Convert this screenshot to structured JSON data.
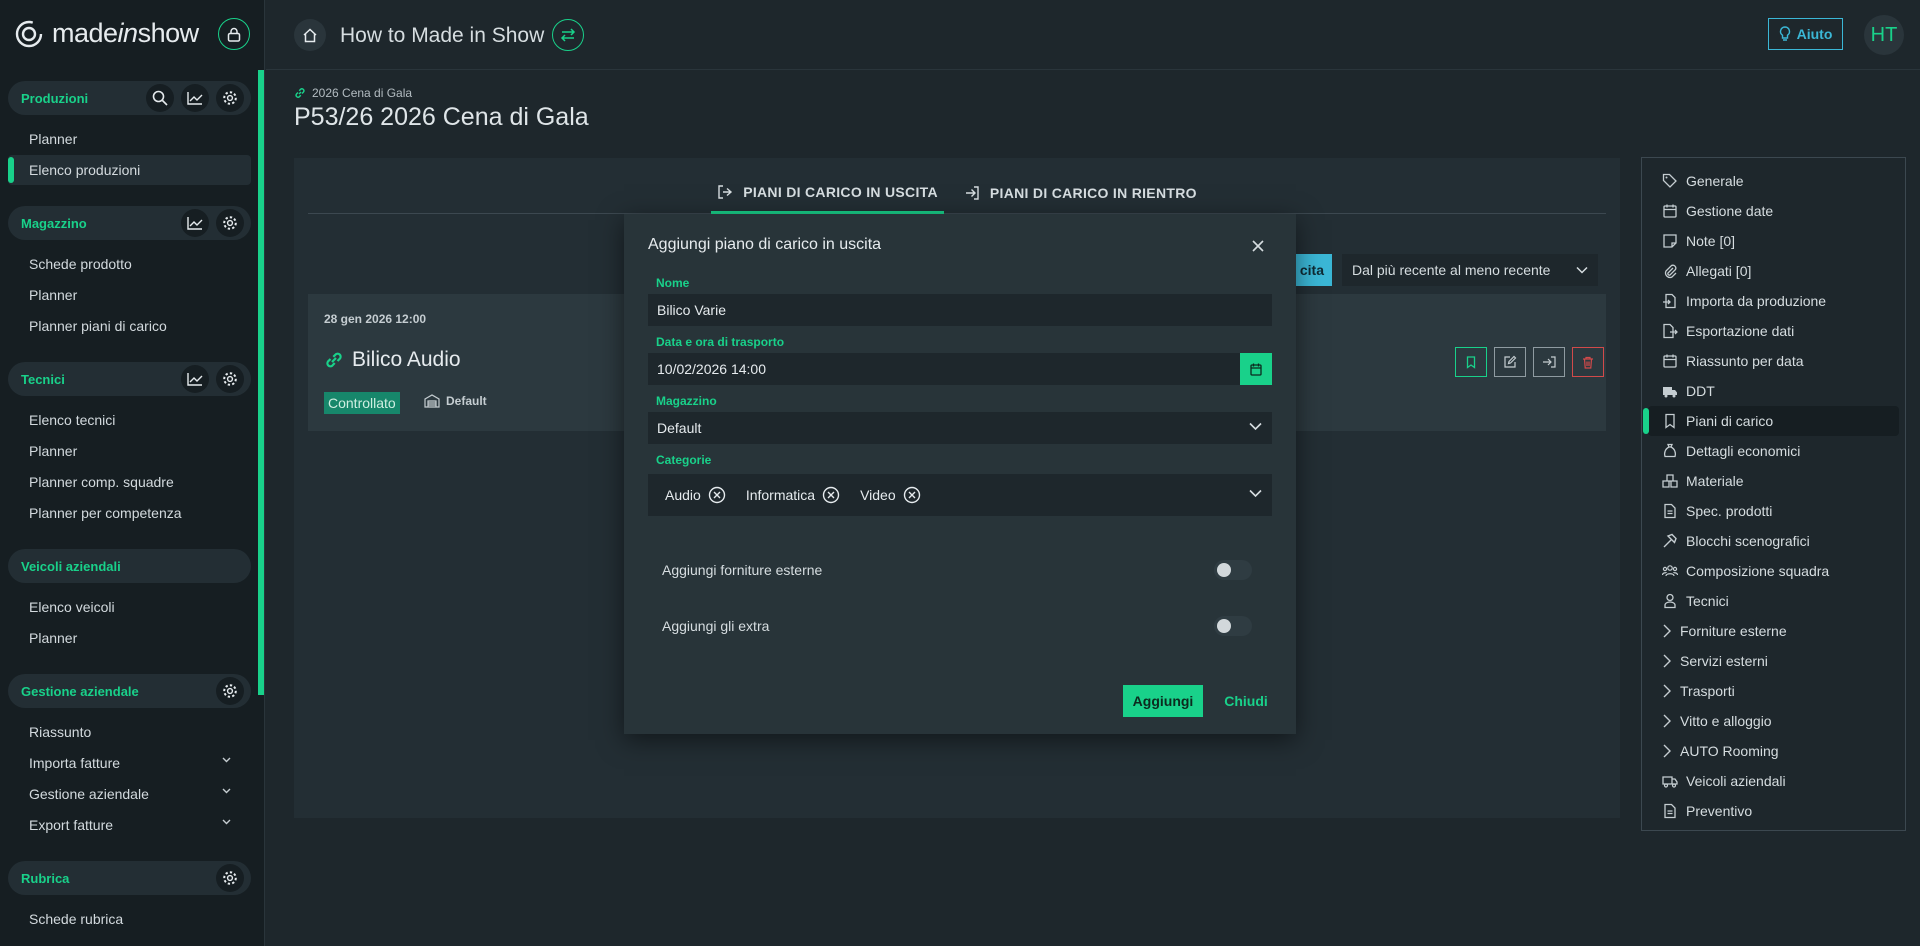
{
  "brand": {
    "name_pre": "made",
    "name_mid": "in",
    "name_post": "show"
  },
  "accent": "#19d18a",
  "info_color": "#3bb7d6",
  "sidebar": {
    "sections": [
      {
        "title": "Produzioni",
        "items": [
          "Planner",
          "Elenco produzioni"
        ],
        "active_item": "Elenco produzioni"
      },
      {
        "title": "Magazzino",
        "items": [
          "Schede prodotto",
          "Planner",
          "Planner piani di carico"
        ]
      },
      {
        "title": "Tecnici",
        "items": [
          "Elenco tecnici",
          "Planner",
          "Planner comp. squadre",
          "Planner per competenza"
        ]
      },
      {
        "title": "Veicoli aziendali",
        "items": [
          "Elenco veicoli",
          "Planner"
        ]
      },
      {
        "title": "Gestione aziendale",
        "items": [
          "Riassunto",
          "Importa fatture",
          "Gestione aziendale",
          "Export fatture"
        ]
      },
      {
        "title": "Rubrica",
        "items": [
          "Schede rubrica"
        ]
      }
    ]
  },
  "topbar": {
    "title": "How to Made in Show",
    "help_label": "Aiuto",
    "avatar_initials": "HT"
  },
  "breadcrumb": "2026 Cena di Gala",
  "page_title": "P53/26 2026 Cena di Gala",
  "tabs": [
    {
      "label": "PIANI DI CARICO IN USCITA",
      "icon": "sign-out-icon",
      "active": true
    },
    {
      "label": "PIANI DI CARICO IN RIENTRO",
      "icon": "sign-in-icon",
      "active": false
    }
  ],
  "toolbar": {
    "new_label_partial": "cita",
    "sort_value": "Dal più recente al meno recente"
  },
  "card": {
    "date": "28 gen 2026 12:00",
    "title": "Bilico Audio",
    "status": "Controllato",
    "warehouse": "Default"
  },
  "right_nav": [
    {
      "label": "Generale",
      "icon": "tag-icon"
    },
    {
      "label": "Gestione date",
      "icon": "calendar-icon"
    },
    {
      "label": "Note [0]",
      "icon": "note-icon"
    },
    {
      "label": "Allegati [0]",
      "icon": "paperclip-icon"
    },
    {
      "label": "Importa da produzione",
      "icon": "import-icon"
    },
    {
      "label": "Esportazione dati",
      "icon": "export-icon"
    },
    {
      "label": "Riassunto per data",
      "icon": "calendar-icon"
    },
    {
      "label": "DDT",
      "icon": "truck-icon"
    },
    {
      "label": "Piani di carico",
      "icon": "bookmark-icon",
      "active": true
    },
    {
      "label": "Dettagli economici",
      "icon": "money-bag-icon"
    },
    {
      "label": "Materiale",
      "icon": "boxes-icon"
    },
    {
      "label": "Spec. prodotti",
      "icon": "file-icon"
    },
    {
      "label": "Blocchi scenografici",
      "icon": "hammer-icon"
    },
    {
      "label": "Composizione squadra",
      "icon": "team-icon"
    },
    {
      "label": "Tecnici",
      "icon": "user-icon"
    },
    {
      "label": "Forniture esterne",
      "icon": "chevron-right-icon"
    },
    {
      "label": "Servizi esterni",
      "icon": "chevron-right-icon"
    },
    {
      "label": "Trasporti",
      "icon": "chevron-right-icon"
    },
    {
      "label": "Vitto e alloggio",
      "icon": "chevron-right-icon"
    },
    {
      "label": "AUTO Rooming",
      "icon": "chevron-right-icon"
    },
    {
      "label": "Veicoli aziendali",
      "icon": "van-icon"
    },
    {
      "label": "Preventivo",
      "icon": "file-icon"
    }
  ],
  "modal": {
    "title": "Aggiungi piano di carico in uscita",
    "name_label": "Nome",
    "name_value": "Bilico Varie",
    "date_label": "Data e ora di trasporto",
    "date_value": "10/02/2026 14:00",
    "warehouse_label": "Magazzino",
    "warehouse_value": "Default",
    "categories_label": "Categorie",
    "categories": [
      "Audio",
      "Informatica",
      "Video"
    ],
    "toggle_external": "Aggiungi forniture esterne",
    "toggle_extra": "Aggiungi gli extra",
    "add_label": "Aggiungi",
    "close_label": "Chiudi"
  }
}
